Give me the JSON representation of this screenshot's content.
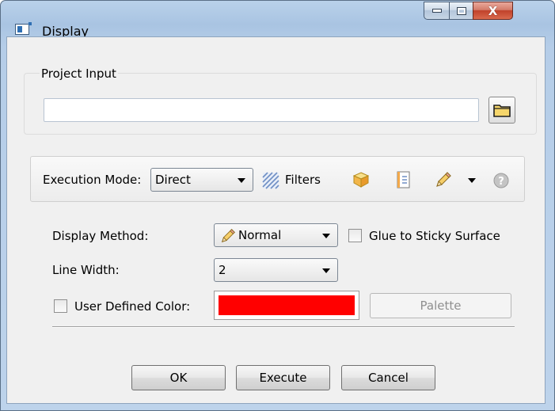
{
  "window": {
    "title": "Display",
    "icon": "window-app-icon"
  },
  "titlebar_buttons": {
    "minimize": "–",
    "maximize": "□",
    "close": "X"
  },
  "project_input": {
    "group_label": "Project Input",
    "path_value": "",
    "browse_icon": "folder-icon"
  },
  "toolbar": {
    "execution_mode_label": "Execution Mode:",
    "execution_mode_value": "Direct",
    "filters_label": "Filters",
    "icons": [
      "filters-icon",
      "cube-icon",
      "document-icon",
      "pencil-icon",
      "dropdown-arrow-icon",
      "help-icon"
    ]
  },
  "form": {
    "display_method_label": "Display Method:",
    "display_method_value": "Normal",
    "glue_label": "Glue to Sticky Surface",
    "line_width_label": "Line Width:",
    "line_width_value": "2",
    "user_color_label": "User Defined Color:",
    "user_color_value": "#ff0000",
    "palette_label": "Palette"
  },
  "footer": {
    "ok_label": "OK",
    "execute_label": "Execute",
    "cancel_label": "Cancel"
  }
}
